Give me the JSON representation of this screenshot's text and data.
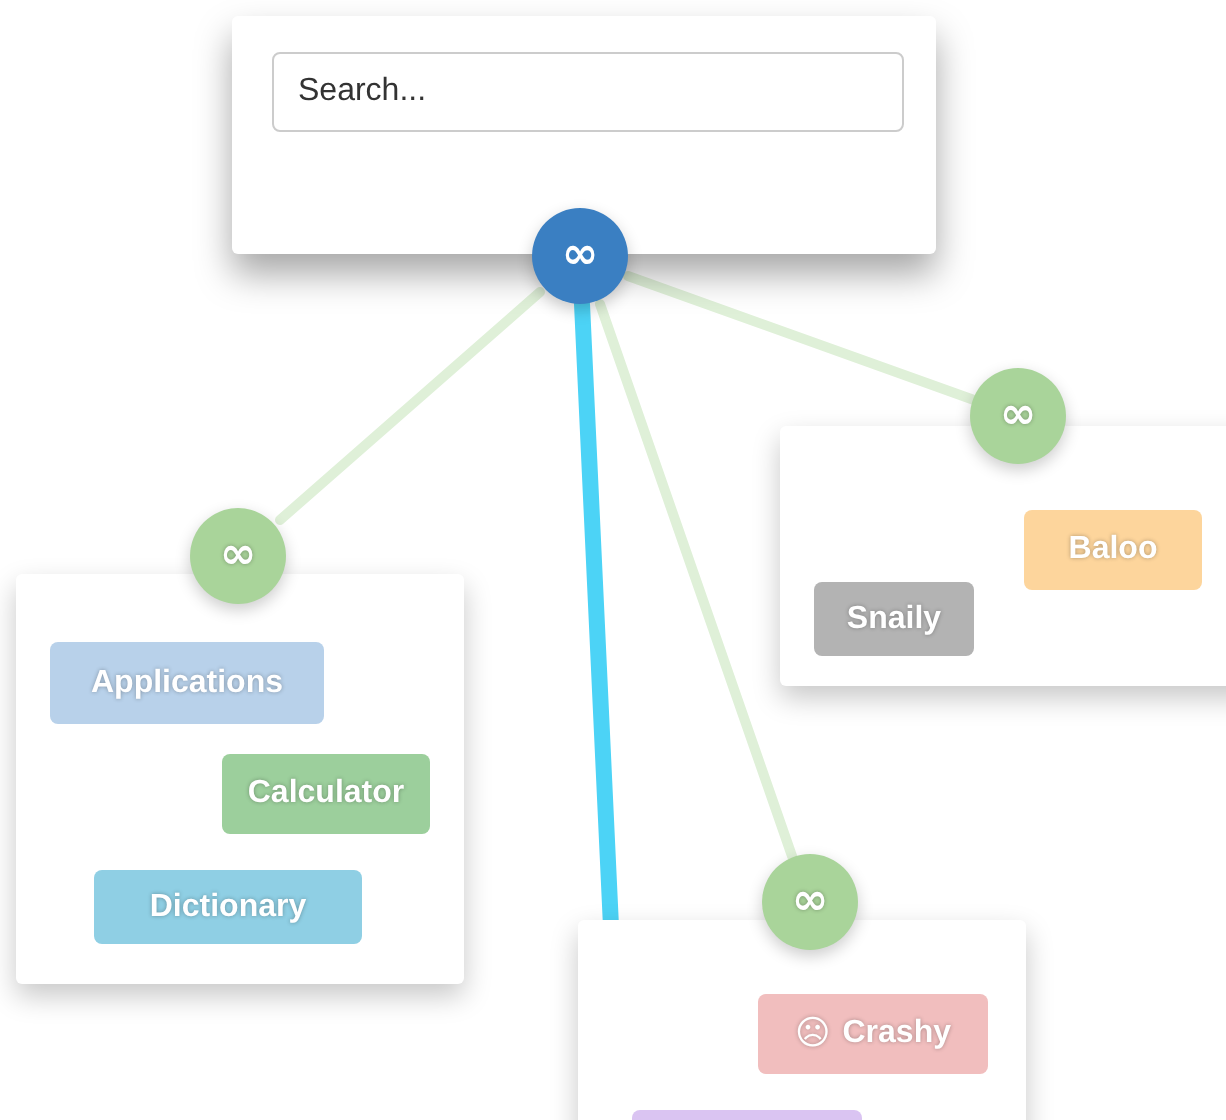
{
  "search_card": {
    "search": {
      "placeholder": "Search..."
    },
    "hub": "∞"
  },
  "groups": [
    {
      "hub": "∞",
      "tags": [
        {
          "label": "Baloo",
          "color": "#fdd59c"
        },
        {
          "label": "Snaily",
          "color": "#b3b3b3"
        }
      ]
    },
    {
      "hub": "∞",
      "tags": [
        {
          "label": "Applications",
          "color": "#b8d1ea"
        },
        {
          "label": "Calculator",
          "color": "#9ccf9c"
        },
        {
          "label": "Dictionary",
          "color": "#8fcfe4"
        }
      ]
    },
    {
      "hub": "∞",
      "tags": [
        {
          "label": "Crashy",
          "icon": "☹",
          "color": "#f1bebe"
        },
        {
          "color": "#dac4f2"
        }
      ]
    }
  ]
}
